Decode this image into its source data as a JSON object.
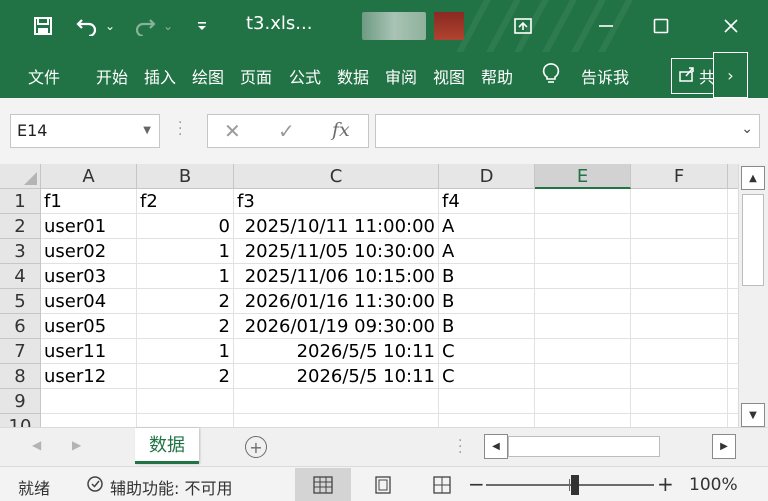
{
  "window": {
    "title": "t3.xls...",
    "quick_access": [
      "save-icon",
      "undo-icon",
      "redo-icon",
      "customize-icon"
    ],
    "buttons": [
      "ribbon-display-icon",
      "minimize-icon",
      "maximize-icon",
      "close-icon"
    ]
  },
  "ribbon": {
    "tabs": [
      "文件",
      "开始",
      "插入",
      "绘图",
      "页面",
      "公式",
      "数据",
      "审阅",
      "视图",
      "帮助"
    ],
    "tell_me": "告诉我",
    "share_partial": "共"
  },
  "formula_bar": {
    "name_box": "E14",
    "fx_label": "fx",
    "value": ""
  },
  "sheet": {
    "columns": [
      "A",
      "B",
      "C",
      "D",
      "E",
      "F"
    ],
    "selected_column": "E",
    "rows": [
      "1",
      "2",
      "3",
      "4",
      "5",
      "6",
      "7",
      "8",
      "9",
      "10"
    ],
    "cells": [
      [
        "f1",
        "f2",
        "f3",
        "f4"
      ],
      [
        "user01",
        "0",
        "2025/10/11 11:00:00",
        "A"
      ],
      [
        "user02",
        "1",
        "2025/11/05 10:30:00",
        "A"
      ],
      [
        "user03",
        "1",
        "2025/11/06 10:15:00",
        "B"
      ],
      [
        "user04",
        "2",
        "2026/01/16 11:30:00",
        "B"
      ],
      [
        "user05",
        "2",
        "2026/01/19 09:30:00",
        "B"
      ],
      [
        "user11",
        "1",
        "2026/5/5 10:11",
        "C"
      ],
      [
        "user12",
        "2",
        "2026/5/5 10:11",
        "C"
      ]
    ],
    "tab_name": "数据"
  },
  "status": {
    "ready": "就绪",
    "accessibility": "辅助功能: 不可用",
    "zoom": "100%",
    "zoom_minus": "−",
    "zoom_plus": "+"
  },
  "colors": {
    "brand": "#217346"
  }
}
